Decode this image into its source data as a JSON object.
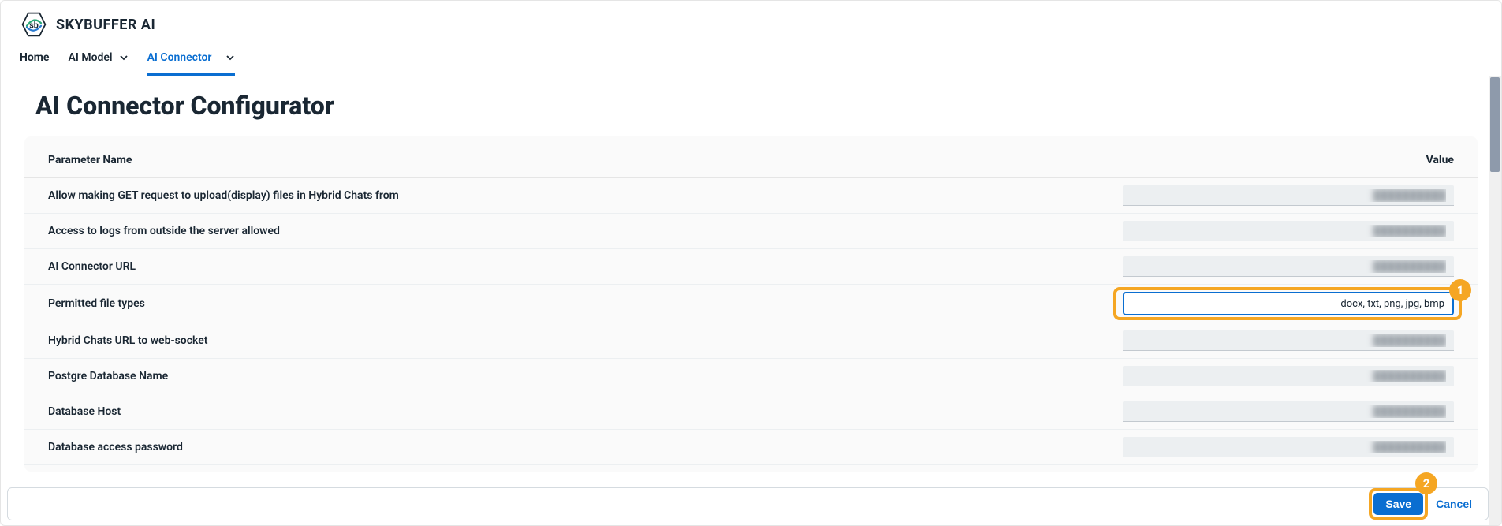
{
  "brand": {
    "name": "SKYBUFFER AI",
    "logo_text": "sb"
  },
  "nav": {
    "items": [
      {
        "label": "Home",
        "has_dropdown": false
      },
      {
        "label": "AI Model",
        "has_dropdown": true
      },
      {
        "label": "AI Connector",
        "has_dropdown": true,
        "active": true
      }
    ]
  },
  "page": {
    "title": "AI Connector Configurator"
  },
  "table": {
    "headers": {
      "param": "Parameter Name",
      "value": "Value"
    },
    "rows": [
      {
        "param": "Allow making GET request to upload(display) files in Hybrid Chats from",
        "value": "",
        "blurred": true
      },
      {
        "param": "Access to logs from outside the server allowed",
        "value": "",
        "blurred": true
      },
      {
        "param": "AI Connector URL",
        "value": "",
        "blurred": true
      },
      {
        "param": "Permitted file types",
        "value": "docx, txt, png, jpg, bmp",
        "focused": true,
        "annotation": "1"
      },
      {
        "param": "Hybrid Chats URL to web-socket",
        "value": "",
        "blurred": true
      },
      {
        "param": "Postgre Database Name",
        "value": "",
        "blurred": true
      },
      {
        "param": "Database Host",
        "value": "",
        "blurred": true
      },
      {
        "param": "Database access password",
        "value": "",
        "blurred": true
      }
    ]
  },
  "footer": {
    "save_label": "Save",
    "cancel_label": "Cancel",
    "save_annotation": "2"
  }
}
